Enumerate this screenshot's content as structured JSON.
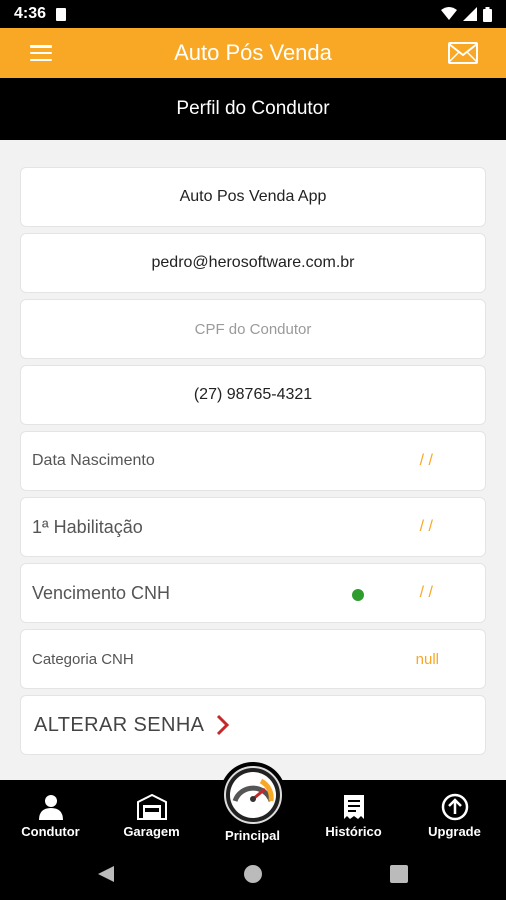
{
  "status_bar": {
    "time": "4:36"
  },
  "header": {
    "title": "Auto Pós Venda",
    "menu_icon": "hamburger-menu-icon",
    "mail_icon": "envelope-icon"
  },
  "subheader": {
    "title": "Perfil do Condutor"
  },
  "profile": {
    "name": "Auto Pos Venda App",
    "email": "pedro@herosoftware.com.br",
    "cpf_placeholder": "CPF do Condutor",
    "phone": "(27) 98765-4321",
    "birth_label": "Data Nascimento",
    "birth_value": "/ /",
    "first_license_label": "1ª Habilitação",
    "first_license_value": "/ /",
    "cnh_expiry_label": "Vencimento CNH",
    "cnh_expiry_value": "/ /",
    "cnh_category_label": "Categoria CNH",
    "cnh_category_value": "null",
    "change_password": "ALTERAR SENHA"
  },
  "colors": {
    "accent": "#f9a825",
    "status_ok": "#2e9d2e",
    "chevron": "#c62828"
  },
  "bottom_nav": [
    {
      "label": "Condutor",
      "icon": "person-icon"
    },
    {
      "label": "Garagem",
      "icon": "garage-icon"
    },
    {
      "label": "Principal",
      "icon": "speedometer-icon"
    },
    {
      "label": "Histórico",
      "icon": "receipt-icon"
    },
    {
      "label": "Upgrade",
      "icon": "upload-arrow-icon"
    }
  ]
}
